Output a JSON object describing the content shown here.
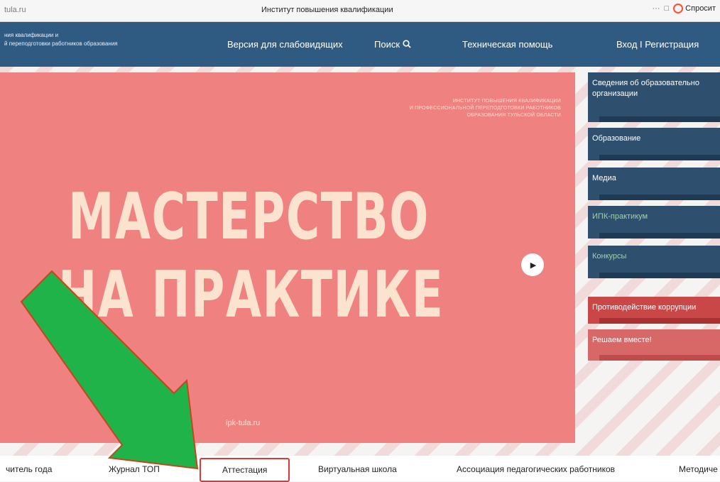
{
  "browser": {
    "url": "tula.ru",
    "tab_title": "Институт повышения квалификации",
    "menu_dots": "···",
    "ask_label": "Спросит"
  },
  "header": {
    "brand_line1": "ния квалификации и",
    "brand_line2": "й переподготовки работников образования",
    "nav": [
      {
        "label": "Версия для слабовидящих"
      },
      {
        "label": "Поиск"
      },
      {
        "label": "Техническая помощь"
      },
      {
        "label": "Вход I Регистрация"
      }
    ]
  },
  "banner": {
    "subtitle_lines": [
      "ИНСТИТУТ ПОВЫШЕНИЯ КВАЛИФИКАЦИИ",
      "И ПРОФЕССИОНАЛЬНОЙ ПЕРЕПОДГОТОВКИ РАБОТНИКОВ",
      "ОБРАЗОВАНИЯ ТУЛЬСКОЙ ОБЛАСТИ"
    ],
    "headline1": "МАСТЕРСТВО",
    "headline2": "НА ПРАКТИКЕ",
    "site": "ipk-tula.ru"
  },
  "side_menu": [
    {
      "label": "Сведения об образовательно организации"
    },
    {
      "label": "Образование"
    },
    {
      "label": "Медиа"
    },
    {
      "label": "ИПК-практикум"
    },
    {
      "label": "Конкурсы"
    },
    {
      "label": "Противодействие коррупции"
    },
    {
      "label": "Решаем вместе!"
    }
  ],
  "bottom_tabs": [
    {
      "label": "читель года"
    },
    {
      "label": "Журнал ТОП"
    },
    {
      "label": "Аттестация"
    },
    {
      "label": "Виртуальная школа"
    },
    {
      "label": "Ассоциация педагогических работников"
    },
    {
      "label": "Методиче"
    }
  ],
  "colors": {
    "header_bg": "#2f5b82",
    "banner_bg": "#ef8181",
    "side_item_bg": "#2f4f6f",
    "highlight_border": "#e23535",
    "arrow_fill": "#1fb34a",
    "arrow_stroke": "#c8441a"
  }
}
